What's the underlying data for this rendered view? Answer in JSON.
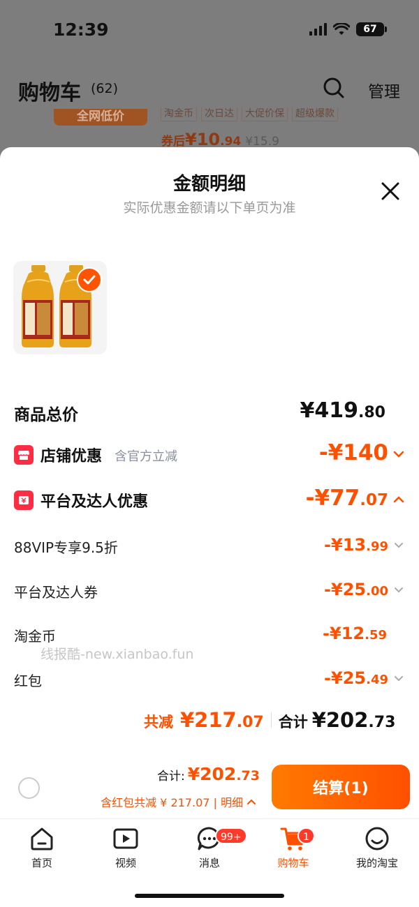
{
  "status_bar": {
    "time": "12:39",
    "battery": "67"
  },
  "background": {
    "title": "购物车",
    "count": "(62)",
    "manage": "管理",
    "lowprice_badge": "全网低价",
    "tags": [
      "淘金币",
      "次日达",
      "大促价保",
      "超级爆款"
    ],
    "price_prefix": "券后",
    "price_int": "¥10",
    "price_dec": ".94",
    "original_price": "¥15.9"
  },
  "sheet": {
    "title": "金额明细",
    "subtitle": "实际优惠金额请以下单页为准",
    "total": {
      "label": "商品总价",
      "int": "¥419",
      "dec": ".80"
    },
    "store_discount": {
      "label": "店铺优惠",
      "note": "含官方立减",
      "value": "-¥140"
    },
    "platform_discount": {
      "label": "平台及达人优惠",
      "int": "-¥77",
      "dec": ".07"
    },
    "items": [
      {
        "label": "88VIP专享9.5折",
        "int": "-¥13",
        "dec": ".99",
        "has_chevron": true
      },
      {
        "label": "平台及达人券",
        "int": "-¥25",
        "dec": ".00",
        "has_chevron": true
      },
      {
        "label": "淘金币",
        "int": "-¥12",
        "dec": ".59",
        "has_chevron": false
      },
      {
        "label": "红包",
        "int": "-¥25",
        "dec": ".49",
        "has_chevron": true
      }
    ],
    "watermark": "线报酷-new.xianbao.fun",
    "summary": {
      "saved_label": "共减",
      "saved_int": "¥217",
      "saved_dec": ".07",
      "total_label": "合计",
      "total_int": "¥202",
      "total_dec": ".73"
    }
  },
  "checkout": {
    "total_label": "合计:",
    "total_int": "¥202",
    "total_dec": ".73",
    "detail": "含红包共减 ¥ 217.07 | 明细",
    "button": "结算(1)"
  },
  "tabbar": {
    "tabs": [
      {
        "label": "首页",
        "icon": "home-icon"
      },
      {
        "label": "视频",
        "icon": "video-icon"
      },
      {
        "label": "消息",
        "icon": "message-icon",
        "badge": "99+"
      },
      {
        "label": "购物车",
        "icon": "cart-icon",
        "badge": "1",
        "active": true
      },
      {
        "label": "我的淘宝",
        "icon": "profile-icon"
      }
    ]
  },
  "colors": {
    "accent": "#ff5000",
    "red_icon": "#ff2c43"
  }
}
